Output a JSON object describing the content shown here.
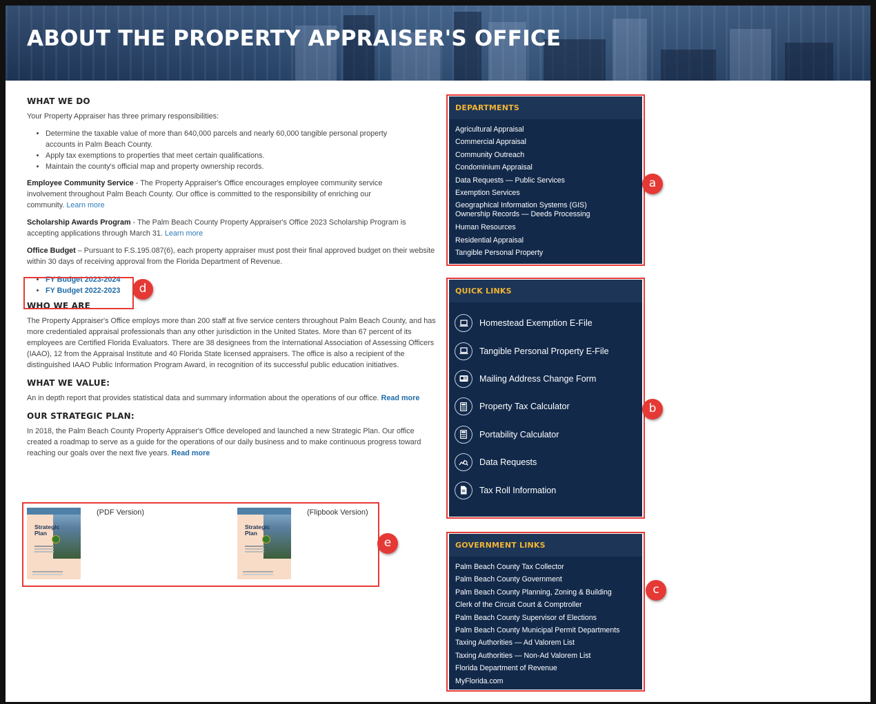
{
  "hero": {
    "title": "ABOUT THE PROPERTY APPRAISER'S OFFICE"
  },
  "what_we_do": {
    "heading": "WHAT WE DO",
    "intro": "Your Property Appraiser has three primary responsibilities:",
    "bullets": [
      "Determine the taxable value of more than 640,000 parcels and nearly 60,000 tangible personal property accounts in Palm Beach County.",
      "Apply tax exemptions to properties that meet certain qualifications.",
      "Maintain the county's official map and property ownership records."
    ],
    "community": {
      "label": "Employee Community Service",
      "text": " - The Property Appraiser's Office encourages employee community service involvement throughout Palm Beach County. Our office is committed to the responsibility of enriching our community. ",
      "link": "Learn more"
    },
    "scholarship": {
      "label": "Scholarship Awards Program",
      "text": " - The Palm Beach County Property Appraiser's Office 2023 Scholarship Program is accepting applications through March 31. ",
      "link": "Learn more"
    },
    "budget": {
      "label": "Office Budget",
      "text": " – Pursuant to F.S.195.087(6), each property appraiser must post their final approved budget on their website within 30 days of receiving approval from the Florida Department of Revenue.",
      "links": [
        "FY Budget 2023-2024",
        "FY Budget 2022-2023"
      ]
    }
  },
  "who_we_are": {
    "heading": "WHO WE ARE",
    "text": "The Property Appraiser's Office employs more than 200 staff at five service centers throughout Palm Beach County, and has more credentialed appraisal professionals than any other jurisdiction in the United States. More than 67 percent of its employees are Certified Florida Evaluators. There are 38 designees from the International Association of Assessing Officers (IAAO), 12 from the Appraisal Institute and 40 Florida State licensed appraisers. The office is also a recipient of the distinguished IAAO Public Information Program Award, in recognition of its successful public education initiatives."
  },
  "what_we_value": {
    "heading": "WHAT WE VALUE:",
    "text": "An in depth report that provides statistical data and summary information about the operations of our office. ",
    "link": "Read more"
  },
  "strategic_plan": {
    "heading": "OUR STRATEGIC PLAN:",
    "text": "In 2018, the Palm Beach County Property Appraiser's Office developed and launched a new Strategic Plan. Our office created a roadmap to serve as a guide for the operations of our daily business and to make continuous progress toward reaching our goals over the next five years. ",
    "link": "Read more",
    "thumb_title_1": "Strategic",
    "thumb_title_2": "Plan",
    "pdf_caption": "(PDF Version)",
    "flipbook_caption": "(Flipbook Version)"
  },
  "departments": {
    "title": "DEPARTMENTS",
    "items": [
      "Agricultural Appraisal",
      "Commercial Appraisal",
      "Community Outreach",
      "Condominium Appraisal",
      "Data Requests — Public Services",
      "Exemption Services",
      "Geographical Information Systems (GIS)",
      "Ownership Records — Deeds Processing",
      "Human Resources",
      "Residential Appraisal",
      "Tangible Personal Property"
    ]
  },
  "quick_links": {
    "title": "QUICK LINKS",
    "items": [
      {
        "label": "Homestead Exemption E-File",
        "icon": "laptop-icon"
      },
      {
        "label": "Tangible Personal Property E-File",
        "icon": "laptop-icon"
      },
      {
        "label": "Mailing Address Change Form",
        "icon": "id-card-icon"
      },
      {
        "label": "Property Tax Calculator",
        "icon": "calculator-icon"
      },
      {
        "label": "Portability Calculator",
        "icon": "calculator-icon"
      },
      {
        "label": "Data Requests",
        "icon": "chart-search-icon"
      },
      {
        "label": "Tax Roll Information",
        "icon": "document-icon"
      }
    ]
  },
  "government_links": {
    "title": "GOVERNMENT LINKS",
    "items": [
      "Palm Beach County Tax Collector",
      "Palm Beach County Government",
      "Palm Beach County Planning, Zoning & Building",
      "Clerk of the Circuit Court & Comptroller",
      "Palm Beach County Supervisor of Elections",
      "Palm Beach County Municipal Permit Departments",
      "Taxing Authorities — Ad Valorem List",
      "Taxing Authorities — Non-Ad Valorem List",
      "Florida Department of Revenue",
      "MyFlorida.com"
    ]
  },
  "annotations": {
    "a": "a",
    "b": "b",
    "c": "c",
    "d": "d",
    "e": "e"
  },
  "colors": {
    "panel_bg": "#12294a",
    "panel_header_text": "#f1b434",
    "link": "#2b7ab8",
    "annotation": "#e53935"
  }
}
